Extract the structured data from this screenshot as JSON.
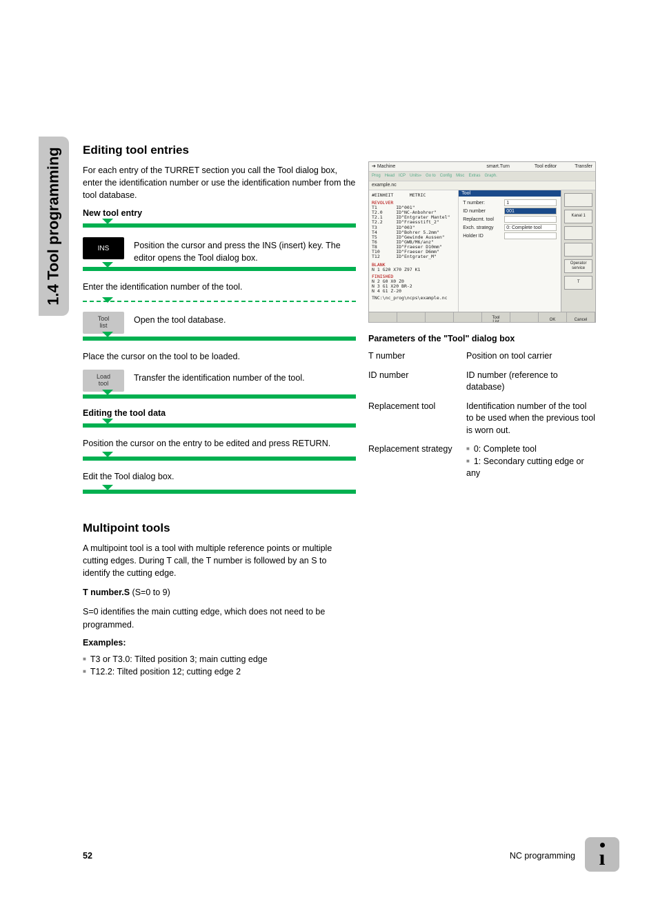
{
  "sideTab": "1.4 Tool programming",
  "h1": "Editing tool entries",
  "intro": "For each entry of the TURRET section you call the Tool dialog box, enter the identification number or use the identification number from the tool database.",
  "subNew": "New tool entry",
  "insKey": "INS",
  "insText": "Position the cursor and press the INS (insert) key. The editor opens the Tool dialog box.",
  "stepEnterId": "Enter the identification number of the tool.",
  "skToolList": "Tool\nlist",
  "stepOpenDb": "Open the tool database.",
  "stepPlaceCursor": "Place the cursor on the tool to be loaded.",
  "skLoadTool": "Load\ntool",
  "stepTransfer": "Transfer the identification number of the tool.",
  "subEdit": "Editing the tool data",
  "stepPosCursor": "Position the cursor on the entry to be edited and press RETURN.",
  "stepEditDlg": "Edit the Tool dialog box.",
  "h2": "Multipoint tools",
  "multiText": "A multipoint tool is a tool with multiple reference points or multiple cutting edges. During T call, the T number is followed by an S to identify the cutting edge.",
  "multiTnum": "T number.S",
  "multiTnumRange": " (S=0 to 9)",
  "multiS0": "S=0 identifies the main cutting edge, which does not need to be programmed.",
  "examplesHead": "Examples:",
  "examples": [
    "T3 or T3.0: Tilted position 3; main cutting edge",
    "T12.2: Tilted position 12; cutting edge 2"
  ],
  "paramsHead": "Parameters of the \"Tool\" dialog box",
  "params": [
    {
      "name": "T number",
      "desc": "Position on tool carrier"
    },
    {
      "name": "ID number",
      "desc": "ID number (reference to database)"
    },
    {
      "name": "Replacement tool",
      "desc": "Identification number of the tool to be used when the previous tool is worn out."
    },
    {
      "name": "Replacement strategy",
      "desc_list": [
        "0: Complete tool",
        "1: Secondary cutting edge or any"
      ]
    }
  ],
  "footer": {
    "page": "52",
    "section": "NC programming"
  },
  "sc": {
    "topLeft": "Machine",
    "topMid": "smart.Turn",
    "topR1": "Tool editor",
    "topR2": "Transfer",
    "modes": [
      "Prog",
      "Head",
      "ICP",
      "Units»",
      "Go to",
      "Config",
      "Misc",
      "Extras",
      "Graph."
    ],
    "file": "example.nc",
    "unitHeader": "#EINHEIT",
    "unitVal": "METRIC",
    "revolver": "REVOLVER",
    "tools": [
      "T1       ID\"001\"",
      "T2.0     ID\"NC-Anbohrer\"",
      "T2.1     ID\"Entgrater Mantel\"",
      "T2.2     ID\"Fraesstift_2\"",
      "T3       ID\"003\"",
      "T4       ID\"Bohrer 5.2mm\"",
      "T5       ID\"Gewinde Aussen\"",
      "T6       ID\"GWB/M6/anz\"",
      "T8       ID\"Fraeser D10mm\"",
      "T10      ID\"Fraeser D6mm\"",
      "T12      ID\"Entgrater_M\""
    ],
    "blank": "BLANK",
    "blankLine": "N   1 G20 X70 Z97 K1",
    "finished": "FINISHED",
    "finLines": [
      "N   2 G0 X0 Z0",
      "N   3 G1 X20 BR-2",
      "N   4 G1 Z-20"
    ],
    "path": "TNC:\\nc_prog\\ncps\\example.nc",
    "dlgTitle": "Tool",
    "fTnum": "T number:",
    "fTnumV": "1",
    "fId": "ID number",
    "fIdV": "001",
    "fRep": "Replacmt. tool",
    "fStrat": "Exch. strategy",
    "fStratV": "0: Complete tool",
    "fHolder": "Holder ID",
    "rightBtns": [
      "",
      "Kanal 1",
      "",
      "",
      "Operator\nservice",
      "T"
    ],
    "sks": [
      "",
      "",
      "",
      "",
      "Tool\nList",
      "",
      "OK",
      "Cancel"
    ]
  }
}
